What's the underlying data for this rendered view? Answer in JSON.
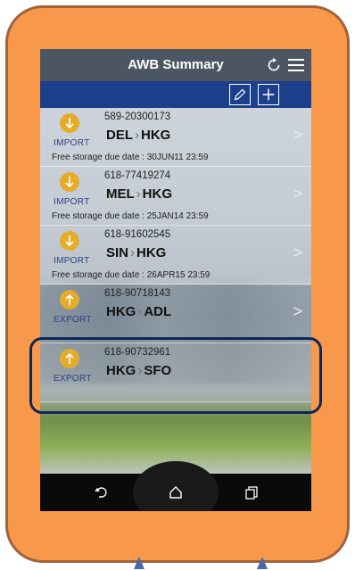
{
  "header": {
    "title": "AWB Summary"
  },
  "icons": {
    "refresh": "refresh-icon",
    "menu": "menu-icon",
    "edit": "edit-icon",
    "add": "add-icon",
    "back": "back-icon",
    "home": "home-icon",
    "recent": "recent-apps-icon"
  },
  "colors": {
    "frame": "#f7984a",
    "title_bar": "#4c5662",
    "toolbar": "#1b3f8a",
    "direction_icon": "#e5ac2a",
    "highlight": "#0f2758"
  },
  "shipments": [
    {
      "direction": "IMPORT",
      "awb": "589-20300173",
      "origin": "DEL",
      "destination": "HKG",
      "storage": "Free storage due date : 30JUN11 23:59"
    },
    {
      "direction": "IMPORT",
      "awb": "618-77419274",
      "origin": "MEL",
      "destination": "HKG",
      "storage": "Free storage due date : 25JAN14 23:59"
    },
    {
      "direction": "IMPORT",
      "awb": "618-91602545",
      "origin": "SIN",
      "destination": "HKG",
      "storage": "Free storage due date : 26APR15 23:59"
    },
    {
      "direction": "EXPORT",
      "awb": "618-90718143",
      "origin": "HKG",
      "destination": "ADL",
      "storage": ""
    },
    {
      "direction": "EXPORT",
      "awb": "618-90732961",
      "origin": "HKG",
      "destination": "SFO",
      "storage": ""
    }
  ]
}
